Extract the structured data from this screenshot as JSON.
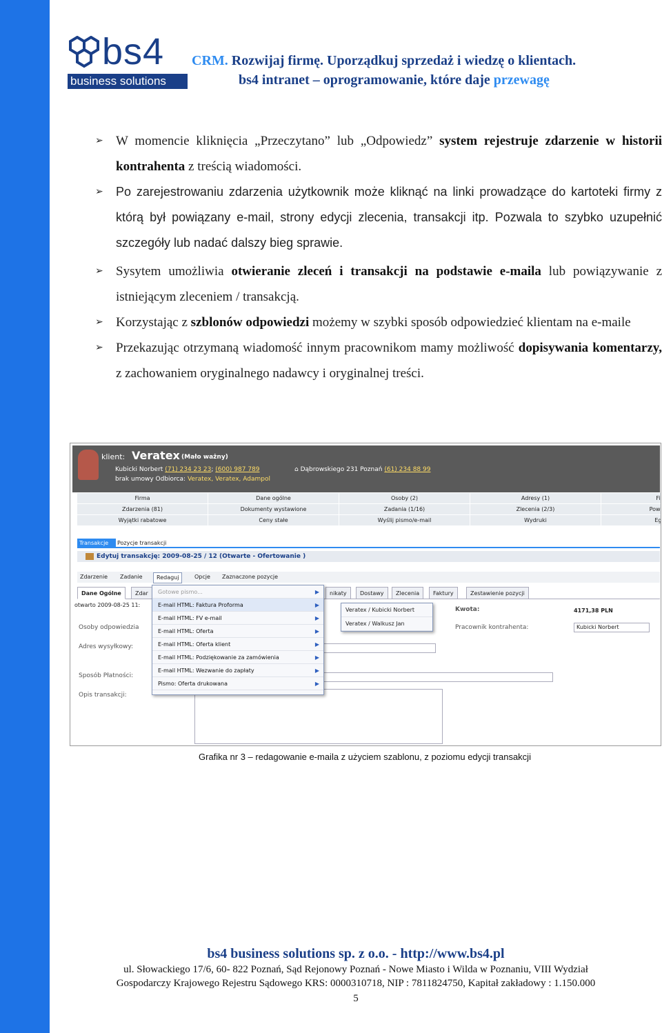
{
  "header": {
    "logo_word": "bs4",
    "logo_band": "business solutions",
    "slogan_line1_accent": "CRM.",
    "slogan_line1": "Rozwijaj firmę. Uporządkuj sprzedaż i wiedzę o klientach.",
    "slogan_line2": "bs4 intranet – oprogramowanie, które daje",
    "slogan_line2_accent": "przewagę"
  },
  "bullets": {
    "b1": {
      "t1": "W momencie kliknięcia „Przeczytano” lub „Odpowiedz”",
      "t2": "system rejestruje zdarzenie w historii kontrahenta",
      "t3": "z treścią wiadomości."
    },
    "b2": "Po zarejestrowaniu zdarzenia użytkownik może kliknąć na linki prowadzące do kartoteki firmy z którą był powiązany e-mail, strony edycji zlecenia, transakcji itp. Pozwala to szybko uzupełnić szczegóły lub nadać dalszy bieg sprawie.",
    "b3": {
      "t1": "Sysytem umożliwia",
      "t2": "otwieranie zleceń i transakcji na podstawie e-maila",
      "t3": "lub powiązywanie z istniejącym zleceniem / transakcją."
    },
    "b4": {
      "t1": "Korzystając z",
      "t2": "szblonów odpowiedzi",
      "t3": "możemy w szybki sposób odpowiedzieć klientam na e-maile"
    },
    "b5": {
      "t1": "Przekazując otrzymaną wiadomość innym pracownikom mamy możliwość",
      "t2": "dopisywania komentarzy,",
      "t3": "z zachowaniem oryginalnego nadawcy i oryginalnej treści."
    }
  },
  "figure": {
    "client_label": "klient:",
    "client_name": "Veratex",
    "client_importance": "(Mało ważny)",
    "contact_name": "Kubicki Norbert",
    "phone1": "(71) 234 23 23",
    "phone2": "(600) 987 789",
    "no_contract": "brak umowy",
    "recipients_label": "Odbiorca:",
    "recipients": "Veratex, Veratex, Adampol",
    "address": "Dąbrowskiego 231 Poznań",
    "address_phone": "(61) 234 88 99",
    "menu": [
      "Firma",
      "Dane ogólne",
      "Osoby (2)",
      "Adresy (1)",
      "Finanse",
      "Zdarzenia (81)",
      "Dokumenty wystawione",
      "Zadania (1/16)",
      "Zlecenia (2/3)",
      "Powiązane g",
      "Wyjątki rabatowe",
      "Ceny stałe",
      "Wyślij pismo/e-mail",
      "Wydruki",
      "Egzempl"
    ],
    "tab_active": "Transakcje",
    "tab_other": "Pozycje transakcji",
    "edit_title": "Edytuj transakcję: 2009-08-25 / 12 (Otwarte - Ofertowanie )",
    "toolbar": [
      "Zdarzenie",
      "Zadanie",
      "Redaguj",
      "Opcje",
      "Zaznaczone pozycje"
    ],
    "subtabs": [
      "Dane Ogólne",
      "Zdar",
      "nikaty",
      "Dostawy",
      "Zlecenia",
      "Faktury",
      "Zestawienie pozycji"
    ],
    "opened": "otwarto 2009-08-25 11:",
    "labels": {
      "osoby": "Osoby odpowiedzia",
      "adres": "Adres wysyłkowy:",
      "sposob": "Sposób Płatności:",
      "opis": "Opis transakcji:",
      "kwota": "Kwota:",
      "kwota_value": "4171,38 PLN",
      "pracownik": "Pracownik kontrahenta:",
      "pracownik_value": "Kubicki Norbert"
    },
    "dropdown": [
      "Gotowe pismo...",
      "E-mail HTML: Faktura Proforma",
      "E-mail HTML: FV e-mail",
      "E-mail HTML: Oferta",
      "E-mail HTML: Oferta klient",
      "E-mail HTML: Podziękowanie za zamówienia",
      "E-mail HTML: Wezwanie do zapłaty",
      "Pismo: Oferta drukowana"
    ],
    "submenu": [
      "Veratex / Kubicki Norbert",
      "Veratex / Walkusz Jan"
    ]
  },
  "caption": "Grafika nr 3 – redagowanie e-maila z użyciem szablonu, z poziomu edycji transakcji",
  "footer": {
    "company": "bs4 business solutions sp. z o.o. - http://www.bs4.pl",
    "address": "ul. Słowackiego 17/6, 60- 822 Poznań, Sąd Rejonowy Poznań - Nowe Miasto i Wilda w Poznaniu, VIII Wydział",
    "registry": "Gospodarczy Krajowego Rejestru Sądowego KRS: 0000310718, NIP : 7811824750, Kapitał zakładowy : 1.150.000",
    "page": "5"
  },
  "colors": {
    "side_bar": "#1e73e6",
    "brand_dark": "#1a3f88",
    "accent": "#2e8bf0"
  }
}
